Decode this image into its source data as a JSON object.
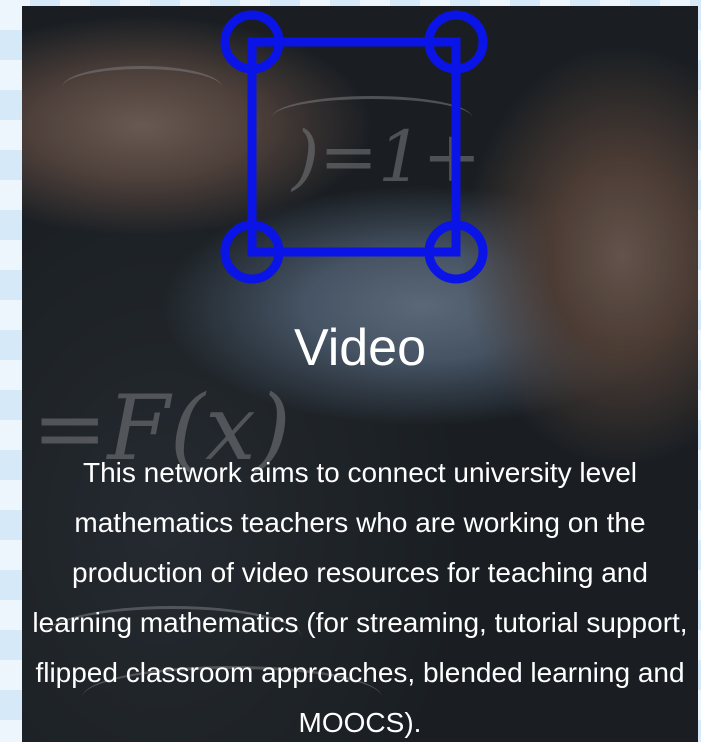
{
  "card": {
    "icon": "bounding-box-icon",
    "title": "Video",
    "description": "This network aims to connect university level mathematics teachers who are working on the production of video resources for teaching and learning mathematics (for streaming, tutorial support, flipped classroom approaches, blended learning and MOOCS)."
  },
  "colors": {
    "icon_stroke": "#0a14e6",
    "overlay": "#12161a",
    "text": "#ffffff",
    "page_background": "#eef6fd"
  }
}
